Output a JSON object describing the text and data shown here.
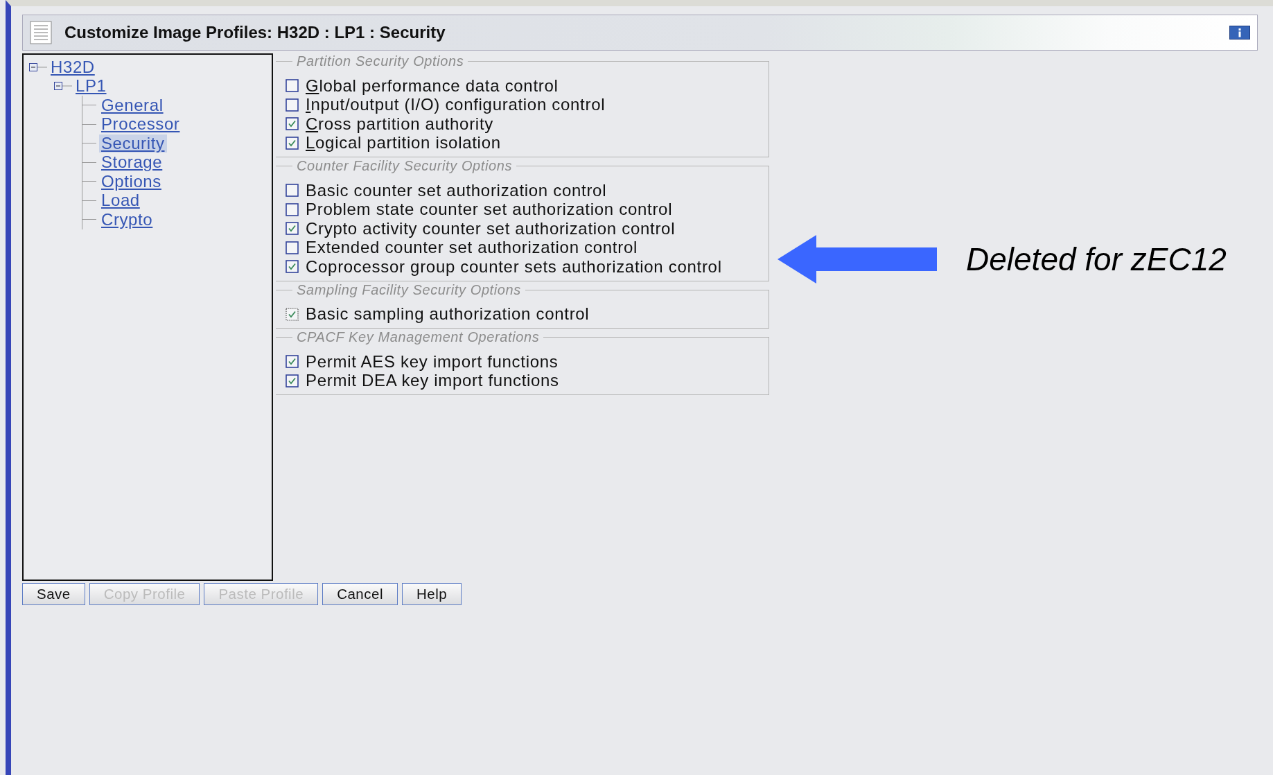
{
  "window": {
    "title": "Customize Image Profiles: H32D : LP1 : Security"
  },
  "tree": [
    {
      "label": "H32D",
      "expanded": true,
      "selected": false,
      "children": [
        {
          "label": "LP1",
          "expanded": true,
          "selected": false,
          "children": [
            {
              "label": "General",
              "selected": false
            },
            {
              "label": "Processor",
              "selected": false
            },
            {
              "label": "Security",
              "selected": true
            },
            {
              "label": "Storage",
              "selected": false
            },
            {
              "label": "Options",
              "selected": false
            },
            {
              "label": "Load",
              "selected": false
            },
            {
              "label": "Crypto",
              "selected": false
            }
          ]
        }
      ]
    }
  ],
  "groups": [
    {
      "title": "Partition Security Options",
      "options": [
        {
          "label": "Global performance data control",
          "checked": false,
          "mnemonic": true,
          "focused": false
        },
        {
          "label": "Input/output (I/O) configuration control",
          "checked": false,
          "mnemonic": true,
          "focused": false
        },
        {
          "label": "Cross partition authority",
          "checked": true,
          "mnemonic": true,
          "focused": false
        },
        {
          "label": "Logical partition isolation",
          "checked": true,
          "mnemonic": true,
          "focused": false
        }
      ]
    },
    {
      "title": "Counter Facility Security Options",
      "options": [
        {
          "label": "Basic counter set authorization control",
          "checked": false,
          "mnemonic": false,
          "focused": false
        },
        {
          "label": "Problem state counter set authorization control",
          "checked": false,
          "mnemonic": false,
          "focused": false
        },
        {
          "label": "Crypto activity counter set authorization control",
          "checked": true,
          "mnemonic": false,
          "focused": false
        },
        {
          "label": "Extended counter set authorization control",
          "checked": false,
          "mnemonic": false,
          "focused": false
        },
        {
          "label": "Coprocessor group counter sets authorization control",
          "checked": true,
          "mnemonic": false,
          "focused": false
        }
      ]
    },
    {
      "title": "Sampling Facility Security Options",
      "options": [
        {
          "label": "Basic sampling authorization control",
          "checked": true,
          "mnemonic": false,
          "focused": true
        }
      ]
    },
    {
      "title": "CPACF Key Management Operations",
      "options": [
        {
          "label": "Permit AES key import functions",
          "checked": true,
          "mnemonic": false,
          "focused": false
        },
        {
          "label": "Permit DEA key import functions",
          "checked": true,
          "mnemonic": false,
          "focused": false
        }
      ]
    }
  ],
  "buttons": [
    {
      "label": "Save",
      "disabled": false
    },
    {
      "label": "Copy Profile",
      "disabled": true
    },
    {
      "label": "Paste Profile",
      "disabled": true
    },
    {
      "label": "Cancel",
      "disabled": false
    },
    {
      "label": "Help",
      "disabled": false
    }
  ],
  "annotation": {
    "text": "Deleted for zEC12"
  }
}
